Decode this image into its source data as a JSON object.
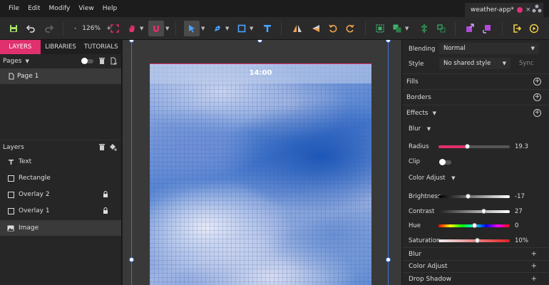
{
  "menu": [
    "File",
    "Edit",
    "Modify",
    "View",
    "Help"
  ],
  "doc_tab": {
    "name": "weather-app*",
    "close": "×"
  },
  "toolbar": {
    "zoom_minus": "-",
    "zoom_value": "126%",
    "zoom_plus": "+"
  },
  "left_tabs": [
    "LAYERS",
    "LIBRARIES",
    "TUTORIALS"
  ],
  "pages": {
    "header": "Pages",
    "items": [
      "Page 1"
    ]
  },
  "layers": {
    "header": "Layers",
    "items": [
      {
        "name": "Text",
        "icon": "text-icon",
        "locked": false
      },
      {
        "name": "Rectangle",
        "icon": "rect-icon",
        "locked": false
      },
      {
        "name": "Overlay 2",
        "icon": "rect-icon",
        "locked": true
      },
      {
        "name": "Overlay 1",
        "icon": "rect-icon",
        "locked": true
      },
      {
        "name": "Image",
        "icon": "image-icon",
        "locked": false,
        "selected": true
      }
    ]
  },
  "canvas": {
    "status_time": "14:00"
  },
  "props": {
    "blending_label": "Blending",
    "blending_value": "Normal",
    "style_label": "Style",
    "style_value": "No shared style",
    "sync": "Sync",
    "fills": "Fills",
    "borders": "Borders",
    "effects": "Effects",
    "blur_select": "Blur",
    "radius_label": "Radius",
    "radius_value": "19.3",
    "radius_fraction": 0.4,
    "clip_label": "Clip",
    "color_adjust_select": "Color Adjust",
    "brightness_label": "Brightness",
    "brightness_value": "-17",
    "contrast_label": "Contrast",
    "contrast_value": "27",
    "hue_label": "Hue",
    "hue_value": "0",
    "saturation_label": "Saturation",
    "saturation_value": "10%",
    "blur_section": "Blur",
    "color_adjust_section": "Color Adjust",
    "drop_shadow_section": "Drop Shadow"
  },
  "colors": {
    "accent": "#e0306e",
    "guide": "#3d74d8"
  }
}
